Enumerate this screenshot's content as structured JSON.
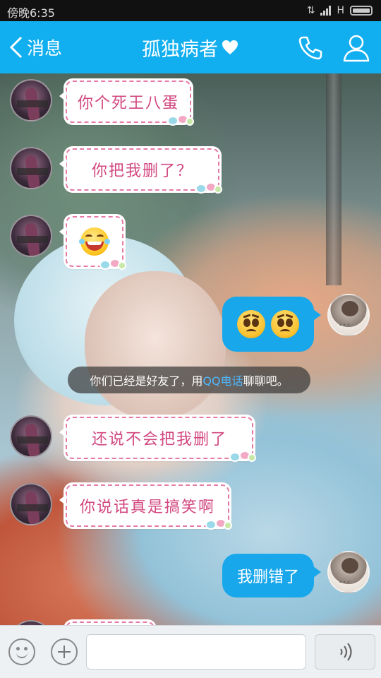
{
  "status_bar": {
    "time": "傍晚6:35",
    "network": "H"
  },
  "header": {
    "back_label": "消息",
    "title": "孤独病者"
  },
  "notice": {
    "before": "你们已经是好友了，用",
    "link": "QQ电话",
    "after": "聊聊吧。"
  },
  "messages": [
    {
      "side": "left",
      "text": "你个死王八蛋"
    },
    {
      "side": "left",
      "text": "你把我删了？"
    },
    {
      "side": "left",
      "emoji": "laughing-tears"
    },
    {
      "side": "right",
      "emoji": "sad-face x2"
    },
    {
      "side": "left",
      "text": "还说不会把我删了"
    },
    {
      "side": "left",
      "text": "你说话真是搞笑啊"
    },
    {
      "side": "right",
      "text": "我删错了"
    }
  ],
  "colors": {
    "header": "#12aff0",
    "bubble_right": "#19a7ec",
    "bubble_left_text": "#d2477f",
    "notice_link": "#4fb8ff"
  }
}
